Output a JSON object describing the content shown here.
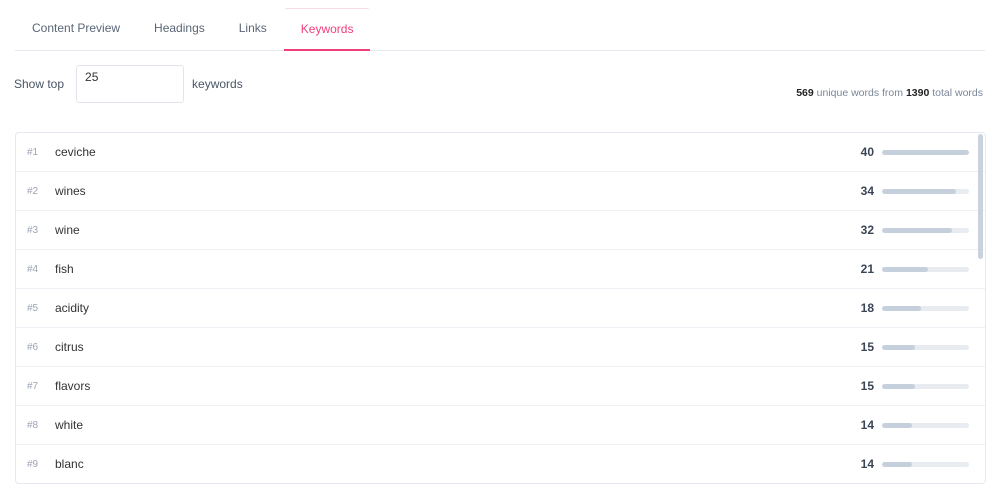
{
  "tabs": [
    "Content Preview",
    "Headings",
    "Links",
    "Keywords"
  ],
  "active_tab": 3,
  "controls": {
    "show_top_label": "Show top",
    "count_value": "25",
    "keywords_label": "keywords"
  },
  "stats": {
    "unique": "569",
    "unique_label": "unique words from",
    "total": "1390",
    "total_label": "total words"
  },
  "keywords": [
    {
      "rank": "#1",
      "word": "ceviche",
      "count": 40
    },
    {
      "rank": "#2",
      "word": "wines",
      "count": 34
    },
    {
      "rank": "#3",
      "word": "wine",
      "count": 32
    },
    {
      "rank": "#4",
      "word": "fish",
      "count": 21
    },
    {
      "rank": "#5",
      "word": "acidity",
      "count": 18
    },
    {
      "rank": "#6",
      "word": "citrus",
      "count": 15
    },
    {
      "rank": "#7",
      "word": "flavors",
      "count": 15
    },
    {
      "rank": "#8",
      "word": "white",
      "count": 14
    },
    {
      "rank": "#9",
      "word": "blanc",
      "count": 14
    }
  ],
  "accent": "#f0407a"
}
